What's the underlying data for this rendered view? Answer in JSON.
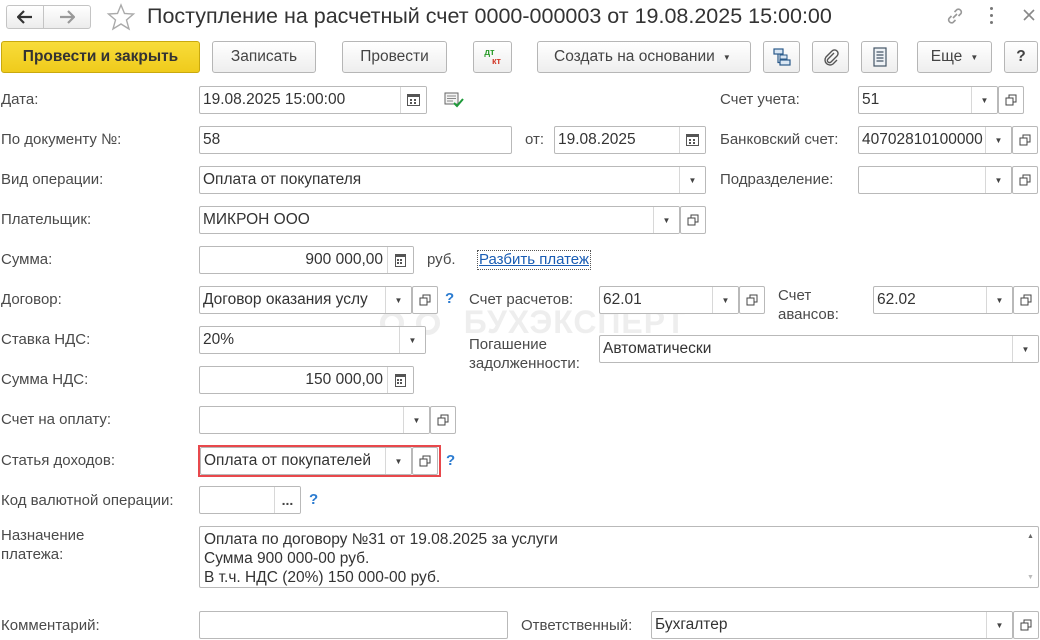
{
  "window": {
    "title": "Поступление на расчетный счет 0000-000003 от 19.08.2025 15:00:00"
  },
  "toolbar": {
    "post_close": "Провести и закрыть",
    "save": "Записать",
    "post": "Провести",
    "dt": "дт",
    "kt": "кт",
    "create_based": "Создать на основании",
    "more": "Еще",
    "help": "?"
  },
  "watermark": "БУХЭКСПЕРТ",
  "form": {
    "date_label": "Дата:",
    "date_value": "19.08.2025 15:00:00",
    "docnum_label": "По документу №:",
    "docnum_value": "58",
    "from_label": "от:",
    "from_value": "19.08.2025",
    "optype_label": "Вид операции:",
    "optype_value": "Оплата от покупателя",
    "payer_label": "Плательщик:",
    "payer_value": "МИКРОН ООО",
    "sum_label": "Сумма:",
    "sum_value": "900 000,00",
    "currency": "руб.",
    "split_link": "Разбить платеж",
    "contract_label": "Договор:",
    "contract_value": "Договор оказания услу",
    "vat_rate_label": "Ставка НДС:",
    "vat_rate_value": "20%",
    "vat_sum_label": "Сумма НДС:",
    "vat_sum_value": "150 000,00",
    "invoice_label": "Счет на оплату:",
    "invoice_value": "",
    "income_label": "Статья доходов:",
    "income_value": "Оплата от покупателей",
    "currency_op_label": "Код валютной операции:",
    "currency_op_value": "",
    "ellipsis": "...",
    "purpose_label": "Назначение платежа:",
    "purpose_lines": [
      "Оплата по договору №31 от 19.08.2025 за услуги",
      "Сумма 900 000-00 руб.",
      "В т.ч. НДС (20%) 150 000-00 руб."
    ],
    "comment_label": "Комментарий:",
    "comment_value": "",
    "account_label": "Счет учета:",
    "account_value": "51",
    "bank_label": "Банковский счет:",
    "bank_value": "40702810100000",
    "division_label": "Подразделение:",
    "division_value": "",
    "settle_label": "Счет расчетов:",
    "settle_value": "62.01",
    "advance_label": "Счет авансов:",
    "advance_value": "62.02",
    "repay_label": "Погашение задолженности:",
    "repay_value": "Автоматически",
    "responsible_label": "Ответственный:",
    "responsible_value": "Бухгалтер"
  },
  "help_mark": "?",
  "colors": {
    "primary_button": "#f5d327",
    "highlight_border": "#e8484c",
    "link": "#1a5db4"
  }
}
